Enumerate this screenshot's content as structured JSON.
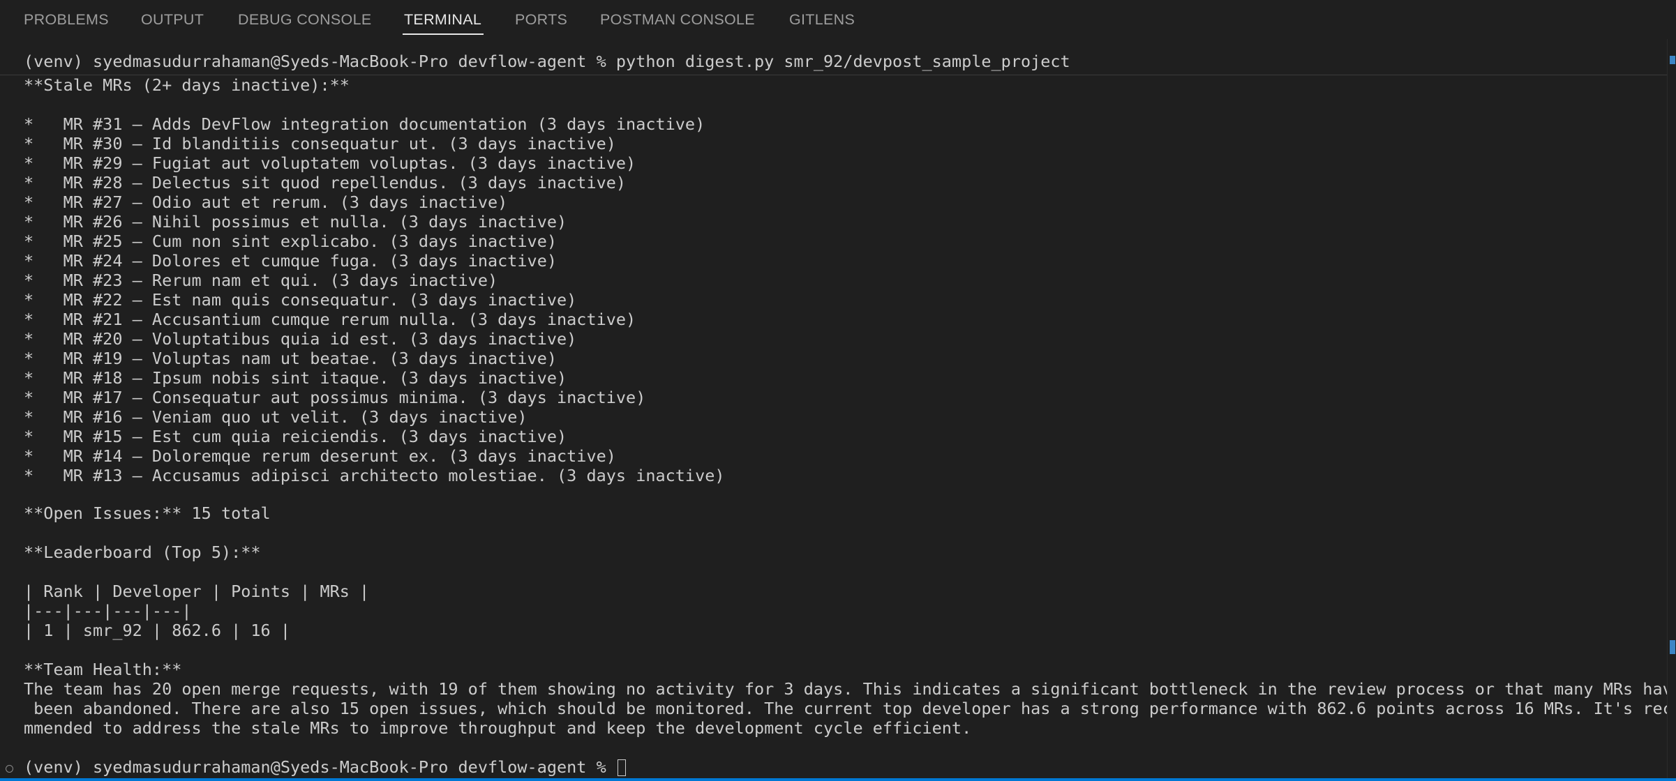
{
  "tabs": [
    {
      "label": "PROBLEMS",
      "active": false
    },
    {
      "label": "OUTPUT",
      "active": false
    },
    {
      "label": "DEBUG CONSOLE",
      "active": false
    },
    {
      "label": "TERMINAL",
      "active": true
    },
    {
      "label": "PORTS",
      "active": false
    },
    {
      "label": "POSTMAN CONSOLE",
      "active": false
    },
    {
      "label": "GITLENS",
      "active": false
    }
  ],
  "terminal": {
    "command_line": "(venv) syedmasudurrahaman@Syeds-MacBook-Pro devflow-agent % python digest.py smr_92/devpost_sample_project",
    "stale_header": "**Stale MRs (2+ days inactive):**",
    "stale_mrs": [
      "*   MR #31 — Adds DevFlow integration documentation (3 days inactive)",
      "*   MR #30 — Id blanditiis consequatur ut. (3 days inactive)",
      "*   MR #29 — Fugiat aut voluptatem voluptas. (3 days inactive)",
      "*   MR #28 — Delectus sit quod repellendus. (3 days inactive)",
      "*   MR #27 — Odio aut et rerum. (3 days inactive)",
      "*   MR #26 — Nihil possimus et nulla. (3 days inactive)",
      "*   MR #25 — Cum non sint explicabo. (3 days inactive)",
      "*   MR #24 — Dolores et cumque fuga. (3 days inactive)",
      "*   MR #23 — Rerum nam et qui. (3 days inactive)",
      "*   MR #22 — Est nam quis consequatur. (3 days inactive)",
      "*   MR #21 — Accusantium cumque rerum nulla. (3 days inactive)",
      "*   MR #20 — Voluptatibus quia id est. (3 days inactive)",
      "*   MR #19 — Voluptas nam ut beatae. (3 days inactive)",
      "*   MR #18 — Ipsum nobis sint itaque. (3 days inactive)",
      "*   MR #17 — Consequatur aut possimus minima. (3 days inactive)",
      "*   MR #16 — Veniam quo ut velit. (3 days inactive)",
      "*   MR #15 — Est cum quia reiciendis. (3 days inactive)",
      "*   MR #14 — Doloremque rerum deserunt ex. (3 days inactive)",
      "*   MR #13 — Accusamus adipisci architecto molestiae. (3 days inactive)"
    ],
    "open_issues_line": "**Open Issues:** 15 total",
    "leaderboard_header": "**Leaderboard (Top 5):**",
    "leaderboard_table": [
      "| Rank | Developer | Points | MRs |",
      "|---|---|---|---|",
      "| 1 | smr_92 | 862.6 | 16 |"
    ],
    "team_health_header": "**Team Health:**",
    "team_health_lines": [
      "The team has 20 open merge requests, with 19 of them showing no activity for 3 days. This indicates a significant bottleneck in the review process or that many MRs have",
      " been abandoned. There are also 15 open issues, which should be monitored. The current top developer has a strong performance with 862.6 points across 16 MRs. It's reco",
      "mmended to address the stale MRs to improve throughput and keep the development cycle efficient."
    ],
    "final_prompt": "(venv) syedmasudurrahaman@Syeds-MacBook-Pro devflow-agent % "
  },
  "colors": {
    "background": "#1f1f1f",
    "text": "#cccccc",
    "tab_inactive": "#9d9d9d",
    "tab_active": "#e7e7e7",
    "status_bar": "#0078d4",
    "scrollbar_marker": "#3d86c6"
  }
}
